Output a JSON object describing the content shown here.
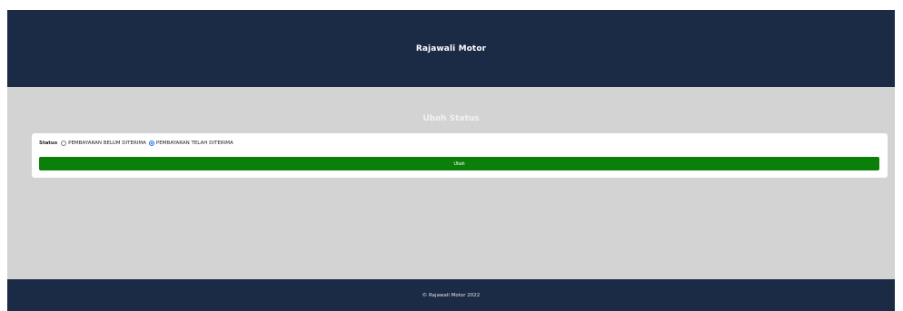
{
  "header": {
    "brand": "Rajawali Motor"
  },
  "main": {
    "title": "Ubah Status",
    "form": {
      "status_label": "Status",
      "options": [
        {
          "label": "PEMBAYARAN BELUM DITERIMA",
          "selected": false
        },
        {
          "label": "PEMBAYARAN TELAH DITERIMA",
          "selected": true
        }
      ],
      "submit_label": "Ubah"
    }
  },
  "footer": {
    "copyright": "© Rajawali Motor 2022"
  },
  "colors": {
    "navbar": "#1b2a45",
    "content_bg": "#d3d3d3",
    "button": "#0a7f0a",
    "radio_selected": "#1a73e8"
  }
}
